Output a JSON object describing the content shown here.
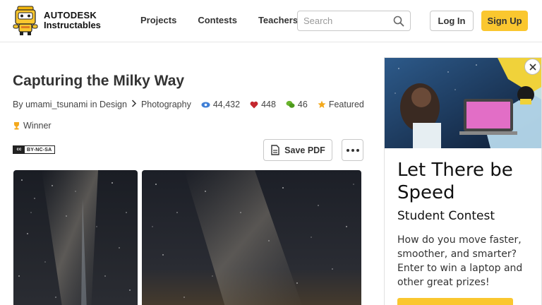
{
  "header": {
    "brand_line1": "AUTODESK",
    "brand_line2": "Instructables",
    "nav": [
      "Projects",
      "Contests",
      "Teachers"
    ],
    "search_placeholder": "Search",
    "login_label": "Log In",
    "signup_label": "Sign Up",
    "accent_color": "#fac72f"
  },
  "article": {
    "title": "Capturing the Milky Way",
    "by_prefix": "By",
    "author": "umami_tsunami",
    "in_word": "in",
    "category": "Design",
    "subcategory": "Photography",
    "views": "44,432",
    "favorites": "448",
    "comments": "46",
    "featured_label": "Featured",
    "winner_label": "Winner",
    "license": "BY-NC-SA",
    "save_pdf_label": "Save PDF"
  },
  "ad": {
    "headline": "Let There be Speed",
    "subheadline": "Student Contest",
    "body": "How do you move faster, smoother, and smarter? Enter to win a laptop and other great prizes!"
  },
  "icons": {
    "views": "eye-icon",
    "favorites": "heart-icon",
    "comments": "chat-bubbles-icon",
    "featured": "star-icon",
    "winner": "trophy-icon",
    "search": "magnifier-icon",
    "close": "close-icon",
    "more": "ellipsis-icon",
    "pdf": "document-icon"
  }
}
